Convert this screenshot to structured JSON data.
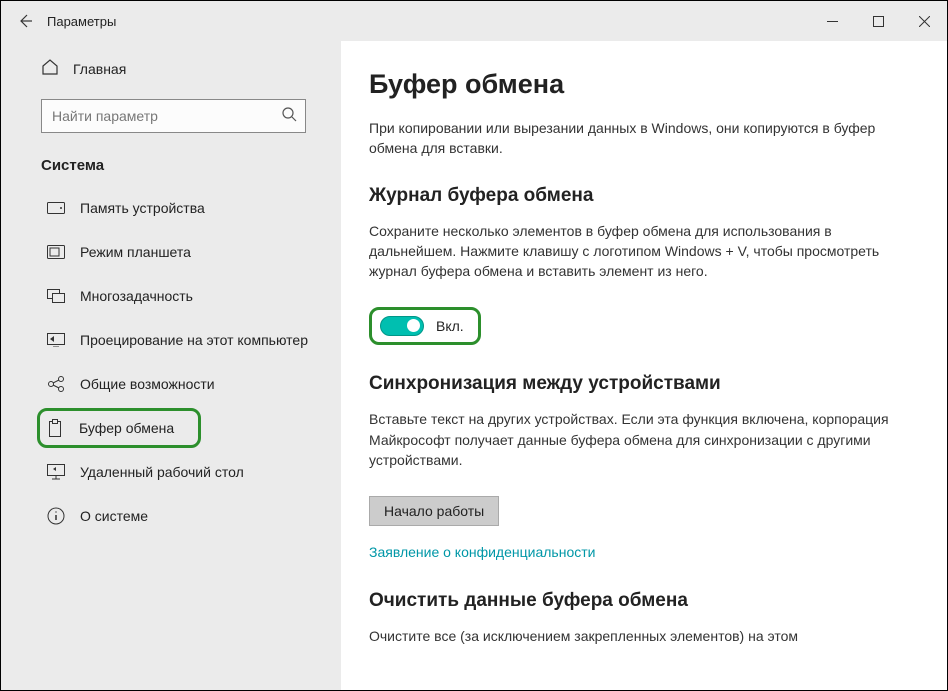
{
  "window": {
    "title": "Параметры"
  },
  "sidebar": {
    "home_label": "Главная",
    "search_placeholder": "Найти параметр",
    "group_label": "Система",
    "items": [
      {
        "label": "Память устройства"
      },
      {
        "label": "Режим планшета"
      },
      {
        "label": "Многозадачность"
      },
      {
        "label": "Проецирование на этот компьютер"
      },
      {
        "label": "Общие возможности"
      },
      {
        "label": "Буфер обмена"
      },
      {
        "label": "Удаленный рабочий стол"
      },
      {
        "label": "О системе"
      }
    ]
  },
  "content": {
    "page_title": "Буфер обмена",
    "intro": "При копировании или вырезании данных в Windows, они копируются в буфер обмена для вставки.",
    "history": {
      "title": "Журнал буфера обмена",
      "desc": "Сохраните несколько элементов в буфер обмена для использования в дальнейшем. Нажмите клавишу с логотипом Windows + V, чтобы просмотреть журнал буфера обмена и вставить элемент из него.",
      "toggle_state": "Вкл."
    },
    "sync": {
      "title": "Синхронизация между устройствами",
      "desc": "Вставьте текст на других устройствах. Если эта функция включена, корпорация Майкрософт получает данные буфера обмена для синхронизации с другими устройствами.",
      "button": "Начало работы",
      "privacy_link": "Заявление о конфиденциальности"
    },
    "clear": {
      "title": "Очистить данные буфера обмена",
      "desc": "Очистите все (за исключением закрепленных элементов) на этом"
    }
  }
}
